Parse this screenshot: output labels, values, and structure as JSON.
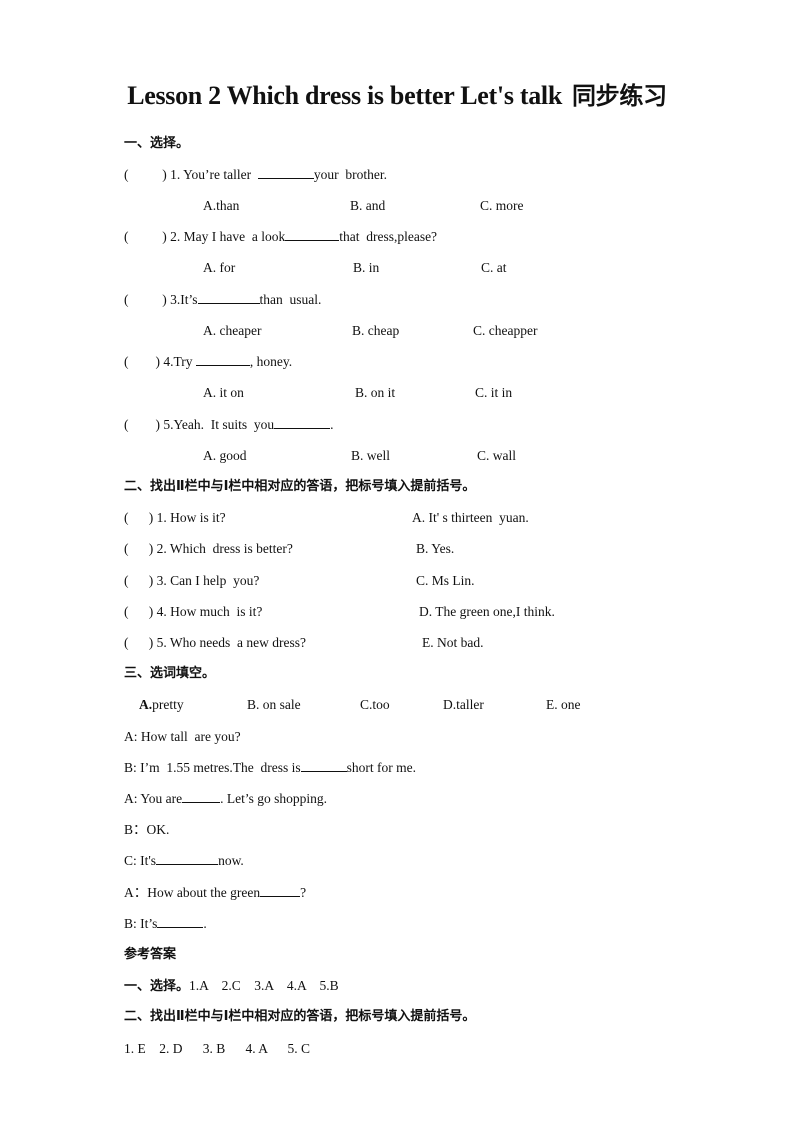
{
  "title": {
    "en": "Lesson 2 Which dress is better Let's talk",
    "cn": "同步练习"
  },
  "section1": {
    "heading": "一、选择。",
    "questions": [
      {
        "stem_before": "(          ) 1. You’re taller  ",
        "stem_after": "your  brother.",
        "options": [
          "A.than",
          "B. and",
          "C. more"
        ]
      },
      {
        "stem_before": "(          ) 2. May I have  a look",
        "stem_after": "that  dress,please?",
        "options": [
          "A. for",
          "B. in",
          "C. at"
        ]
      },
      {
        "stem_before": "(          ) 3.It’s",
        "stem_after": "than  usual.",
        "options": [
          "A. cheaper",
          "B. cheap",
          "C. cheapper"
        ]
      },
      {
        "stem_before": "(        ) 4.Try ",
        "stem_after": ", honey.",
        "options": [
          "A. it on",
          "B. on it",
          "C. it in"
        ]
      },
      {
        "stem_before": "(        ) 5.Yeah.  It suits  you",
        "stem_after": ".",
        "options": [
          "A. good",
          "B. well",
          "C. wall"
        ]
      }
    ]
  },
  "section2": {
    "heading": "二、找出Ⅱ栏中与Ⅰ栏中相对应的答语，把标号填入提前括号。",
    "rows": [
      {
        "question": "(      ) 1. How is it?",
        "answer": "A. It' s thirteen  yuan."
      },
      {
        "question": "(      ) 2. Which  dress is better?",
        "answer": "B. Yes."
      },
      {
        "question": "(      ) 3. Can I help  you?",
        "answer": "C. Ms Lin."
      },
      {
        "question": "(      ) 4. How much  is it?",
        "answer": "D. The green one,I think."
      },
      {
        "question": "(      ) 5. Who needs  a new dress?",
        "answer": "E. Not bad."
      }
    ]
  },
  "section3": {
    "heading": "三、选词填空。",
    "word_bank": [
      {
        "letter": "A.",
        "word": "pretty"
      },
      {
        "letter": "B.",
        "word": " on sale"
      },
      {
        "letter": "C.",
        "word": "too"
      },
      {
        "letter": "D.",
        "word": "taller"
      },
      {
        "letter": "E.",
        "word": " one"
      }
    ],
    "dialogue": [
      {
        "before": "A: How tall  are you?",
        "after": ""
      },
      {
        "before": "B: I’m  1.55 metres.The  dress is",
        "after": "short for me."
      },
      {
        "before": "A: You are",
        "after": ". Let’s go shopping."
      },
      {
        "before": "B：OK.",
        "after": ""
      },
      {
        "before": "C: It's",
        "after": "now."
      },
      {
        "before": "A：How about the green",
        "after": "?"
      },
      {
        "before": "B: It’s",
        "after": "."
      }
    ]
  },
  "answers": {
    "heading": "参考答案",
    "section1_label": "一、选择。",
    "section1_values": "1.A    2.C    3.A    4.A    5.B",
    "section2_label": "二、找出Ⅱ栏中与Ⅰ栏中相对应的答语，把标号填入提前括号。",
    "section2_values": "1. E    2. D      3. B      4. A      5. C"
  }
}
